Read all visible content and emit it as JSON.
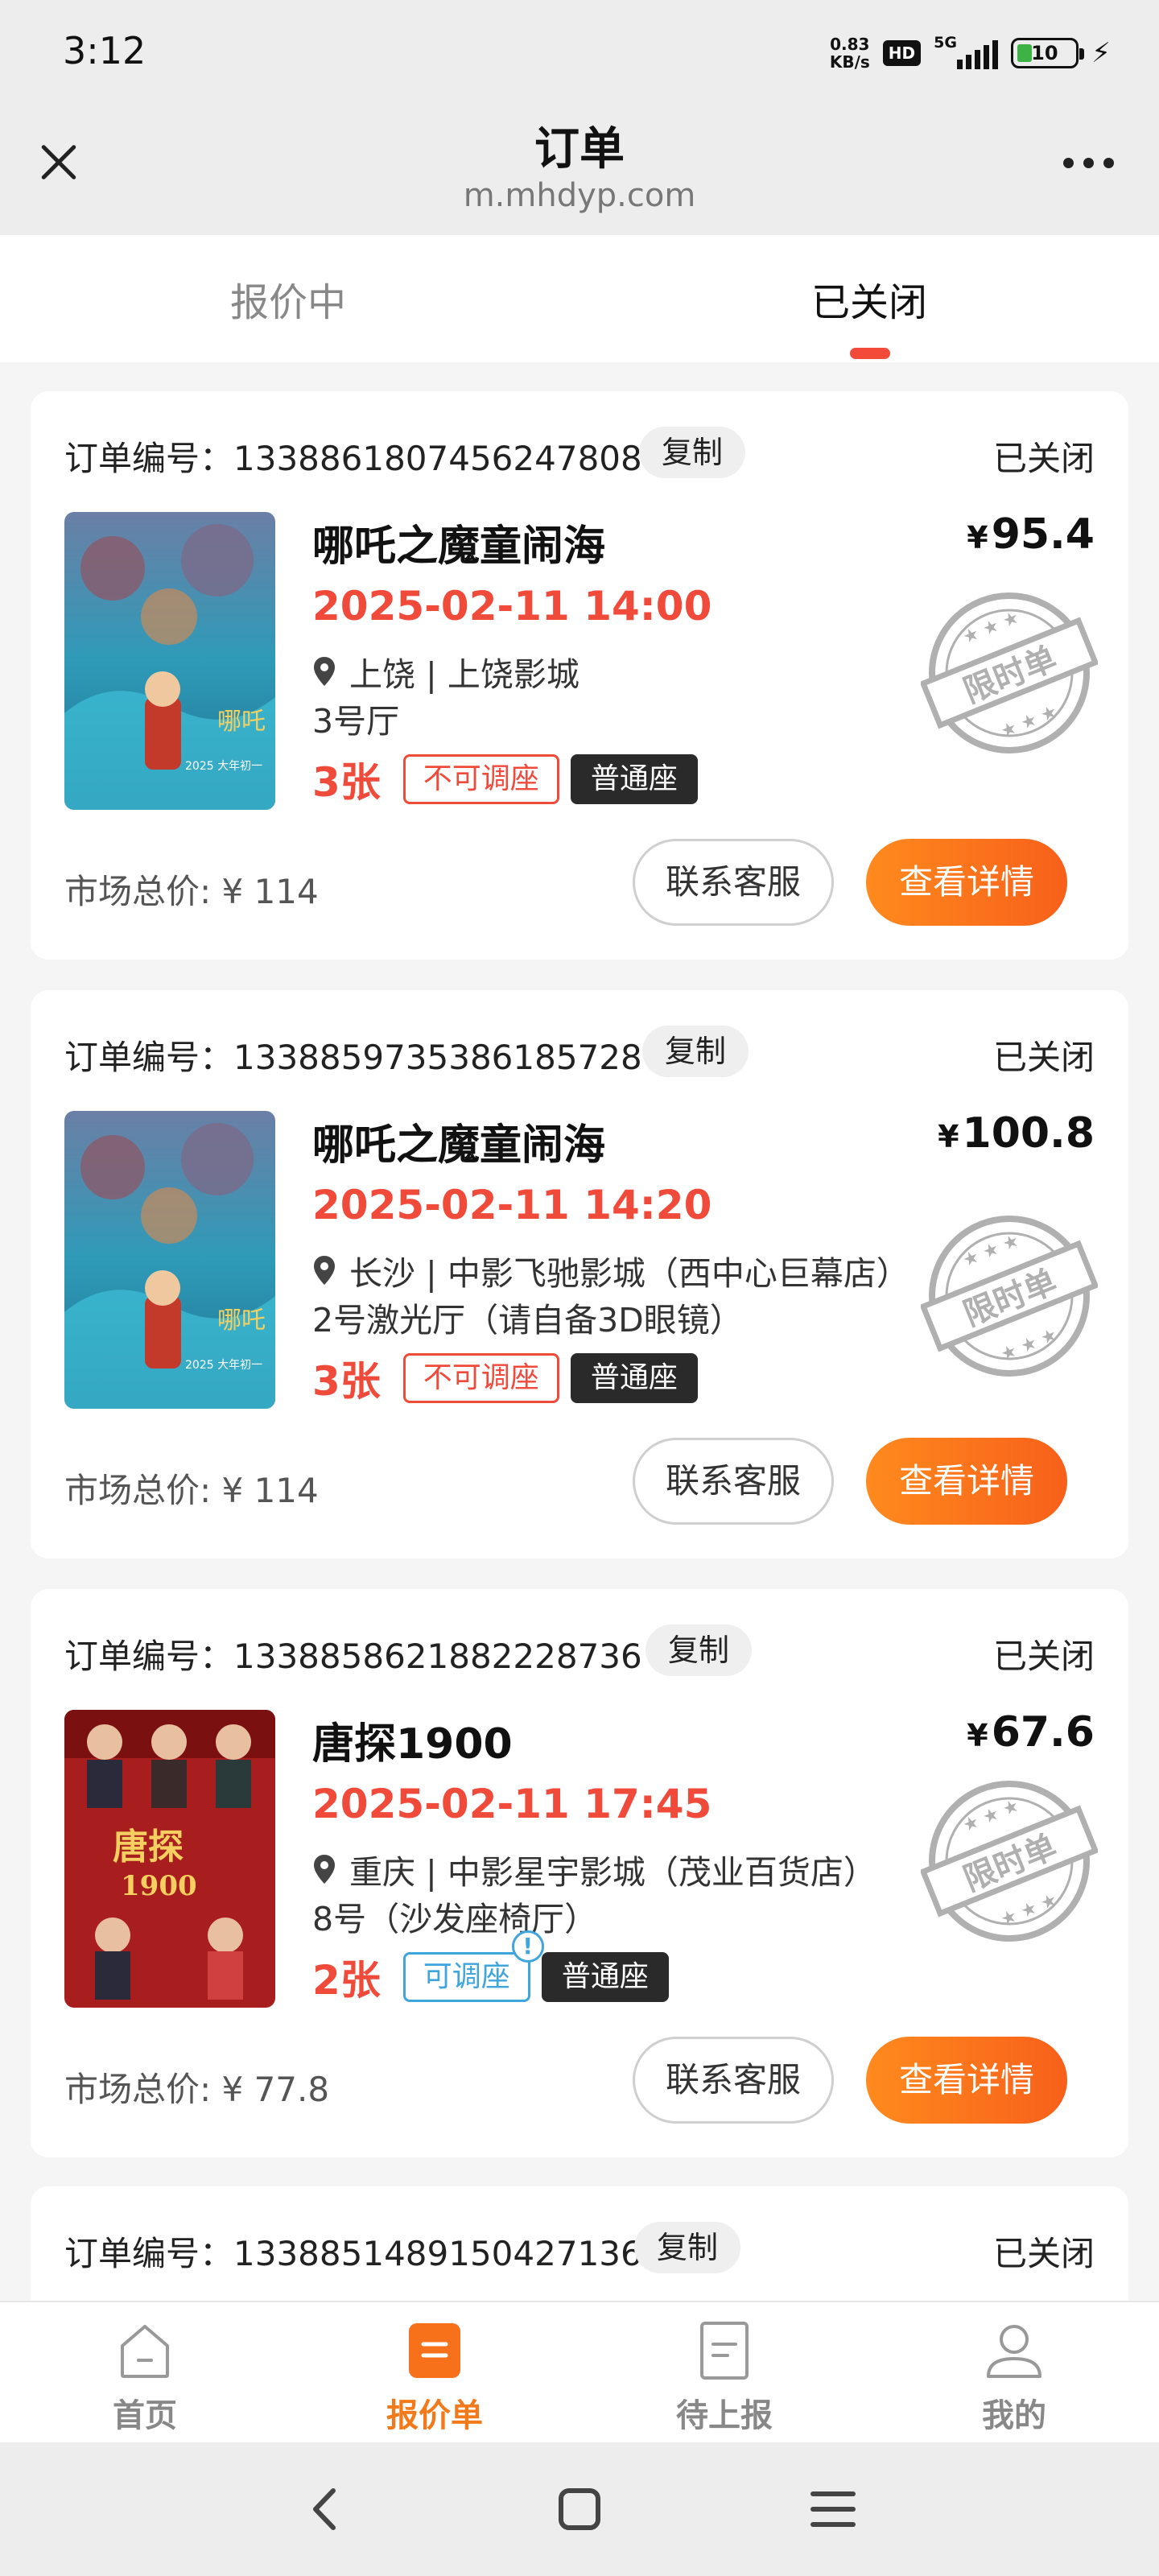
{
  "status_bar": {
    "time": "3:12",
    "net_speed_value": "0.83",
    "net_speed_unit": "KB/s",
    "hd": "HD",
    "signal": "5G",
    "battery": "10"
  },
  "header": {
    "title": "订单",
    "url": "m.mhdyp.com"
  },
  "tabs": [
    {
      "label": "报价中",
      "active": false
    },
    {
      "label": "已关闭",
      "active": true
    }
  ],
  "colors": {
    "accent_orange": "#f7601a",
    "price_red": "#f04a3a",
    "tab_indicator": "#f24b3a",
    "tag_blue": "#3fa5dd"
  },
  "orders": [
    {
      "order_label": "订单编号：",
      "order_no": "1338861807456247808",
      "copy_label": "复制",
      "status": "已关闭",
      "movie": "哪吒之魔童闹海",
      "poster": "nezha-poster",
      "currency": "¥",
      "price": "95.4",
      "showtime": "2025-02-11 14:00",
      "cinema": "上饶 | 上饶影城",
      "hall": "3号厅",
      "tickets": "3张",
      "seat_adjust": "不可调座",
      "seat_type": "普通座",
      "stamp": "限时单",
      "market_price": "市场总价: ¥ 114",
      "service_button": "联系客服",
      "detail_button": "查看详情"
    },
    {
      "order_label": "订单编号：",
      "order_no": "1338859735386185728",
      "copy_label": "复制",
      "status": "已关闭",
      "movie": "哪吒之魔童闹海",
      "poster": "nezha-poster",
      "currency": "¥",
      "price": "100.8",
      "showtime": "2025-02-11 14:20",
      "cinema": "长沙 | 中影飞驰影城（西中心巨幕店）",
      "hall": "2号激光厅（请自备3D眼镜）",
      "tickets": "3张",
      "seat_adjust": "不可调座",
      "seat_type": "普通座",
      "stamp": "限时单",
      "market_price": "市场总价: ¥ 114",
      "service_button": "联系客服",
      "detail_button": "查看详情"
    },
    {
      "order_label": "订单编号：",
      "order_no": "1338858621882228736",
      "copy_label": "复制",
      "status": "已关闭",
      "movie": "唐探1900",
      "poster": "tangtan-poster",
      "currency": "¥",
      "price": "67.6",
      "showtime": "2025-02-11 17:45",
      "cinema": "重庆 | 中影星宇影城（茂业百货店）",
      "hall": "8号（沙发座椅厅）",
      "tickets": "2张",
      "seat_adjust": "可调座",
      "seat_adjust_info": "!",
      "seat_type": "普通座",
      "stamp": "限时单",
      "market_price": "市场总价: ¥ 77.8",
      "service_button": "联系客服",
      "detail_button": "查看详情"
    },
    {
      "order_label": "订单编号：",
      "order_no": "1338851489150427136",
      "copy_label": "复制",
      "status": "已关闭"
    }
  ],
  "bottom_nav": [
    {
      "label": "首页",
      "icon": "home-icon",
      "active": false
    },
    {
      "label": "报价单",
      "icon": "quote-icon",
      "active": true
    },
    {
      "label": "待上报",
      "icon": "pending-icon",
      "active": false
    },
    {
      "label": "我的",
      "icon": "profile-icon",
      "active": false
    }
  ]
}
